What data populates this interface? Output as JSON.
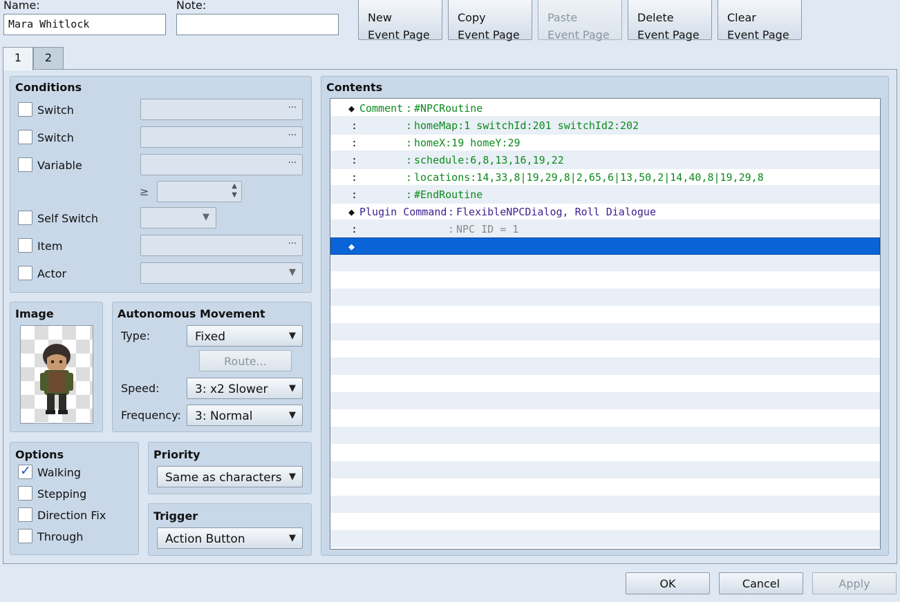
{
  "name": {
    "label": "Name:",
    "value": "Mara Whitlock"
  },
  "note": {
    "label": "Note:",
    "value": ""
  },
  "top_buttons": [
    {
      "line1": "New",
      "line2": "Event Page",
      "enabled": true
    },
    {
      "line1": "Copy",
      "line2": "Event Page",
      "enabled": true
    },
    {
      "line1": "Paste",
      "line2": "Event Page",
      "enabled": false
    },
    {
      "line1": "Delete",
      "line2": "Event Page",
      "enabled": true
    },
    {
      "line1": "Clear",
      "line2": "Event Page",
      "enabled": true
    }
  ],
  "tabs": [
    "1",
    "2"
  ],
  "conditions": {
    "title": "Conditions",
    "switch1": "Switch",
    "switch2": "Switch",
    "variable": "Variable",
    "gte": "≥",
    "self_switch": "Self Switch",
    "item": "Item",
    "actor": "Actor"
  },
  "image": {
    "title": "Image"
  },
  "movement": {
    "title": "Autonomous Movement",
    "type_label": "Type:",
    "type_value": "Fixed",
    "route_button": "Route...",
    "speed_label": "Speed:",
    "speed_value": "3: x2 Slower",
    "frequency_label": "Frequency:",
    "frequency_value": "3: Normal"
  },
  "options": {
    "title": "Options",
    "walking": {
      "label": "Walking",
      "checked": true
    },
    "stepping": {
      "label": "Stepping",
      "checked": false
    },
    "direction_fix": {
      "label": "Direction Fix",
      "checked": false
    },
    "through": {
      "label": "Through",
      "checked": false
    }
  },
  "priority": {
    "title": "Priority",
    "value": "Same as characters"
  },
  "trigger": {
    "title": "Trigger",
    "value": "Action Button"
  },
  "contents": {
    "title": "Contents",
    "rows": [
      {
        "prefix": "◆",
        "command": "Comment",
        "sep": ":",
        "text": "#NPCRoutine"
      },
      {
        "prefix": ":",
        "command": "",
        "sep": ":",
        "text": "homeMap:1 switchId:201 switchId2:202"
      },
      {
        "prefix": ":",
        "command": "",
        "sep": ":",
        "text": "homeX:19 homeY:29"
      },
      {
        "prefix": ":",
        "command": "",
        "sep": ":",
        "text": "schedule:6,8,13,16,19,22"
      },
      {
        "prefix": ":",
        "command": "",
        "sep": ":",
        "text": "locations:14,33,8|19,29,8|2,65,6|13,50,2|14,40,8|19,29,8"
      },
      {
        "prefix": ":",
        "command": "",
        "sep": ":",
        "text": "#EndRoutine"
      },
      {
        "prefix": "◆",
        "command": "Plugin Command",
        "sep": ":",
        "text": "FlexibleNPCDialog, Roll Dialogue"
      },
      {
        "prefix": ":",
        "command": "",
        "sep": ":",
        "text": "NPC ID = 1"
      },
      {
        "prefix": "◆",
        "command": "",
        "sep": "",
        "text": ""
      }
    ]
  },
  "footer": {
    "ok": "OK",
    "cancel": "Cancel",
    "apply": "Apply"
  },
  "colors": {
    "comment_text": "#0a8a1a",
    "plugin_text": "#3a1f8f",
    "selection": "#0a64d8"
  }
}
